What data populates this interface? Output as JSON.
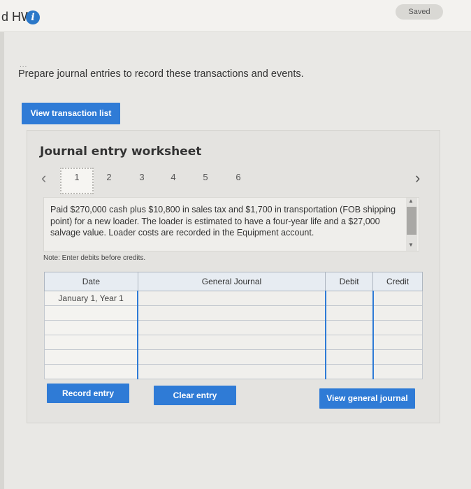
{
  "header": {
    "title": "d HW",
    "saved_label": "Saved"
  },
  "instructions": {
    "dots": "...",
    "text": "Prepare journal entries to record these transactions and events."
  },
  "buttons": {
    "view_transaction_list": "View transaction list",
    "record_entry": "Record entry",
    "clear_entry": "Clear entry",
    "view_general_journal": "View general journal"
  },
  "worksheet": {
    "title": "Journal entry worksheet",
    "pages": [
      "1",
      "2",
      "3",
      "4",
      "5",
      "6"
    ],
    "active_page": "1",
    "description": "Paid $270,000 cash plus $10,800 in sales tax and $1,700 in transportation (FOB shipping point) for a new loader. The loader is estimated to have a four-year life and a $27,000 salvage value. Loader costs are recorded in the Equipment account.",
    "note": "Note: Enter debits before credits."
  },
  "table": {
    "headers": [
      "Date",
      "General Journal",
      "Debit",
      "Credit"
    ],
    "rows": [
      {
        "date": "January 1, Year 1",
        "account": "",
        "debit": "",
        "credit": ""
      },
      {
        "date": "",
        "account": "",
        "debit": "",
        "credit": ""
      },
      {
        "date": "",
        "account": "",
        "debit": "",
        "credit": ""
      },
      {
        "date": "",
        "account": "",
        "debit": "",
        "credit": ""
      },
      {
        "date": "",
        "account": "",
        "debit": "",
        "credit": ""
      },
      {
        "date": "",
        "account": "",
        "debit": "",
        "credit": ""
      }
    ]
  },
  "icons": {
    "info": "info-icon",
    "prev": "chevron-left-icon",
    "next": "chevron-right-icon"
  },
  "colors": {
    "accent": "#2f7bd6",
    "info": "#2b78c8"
  }
}
